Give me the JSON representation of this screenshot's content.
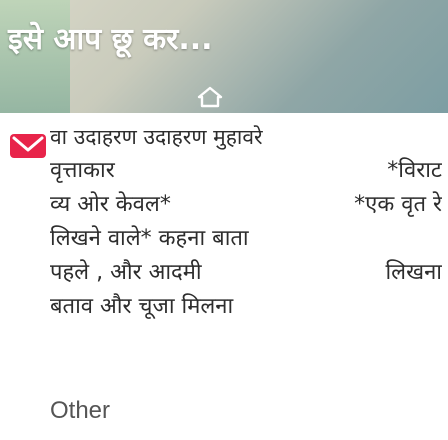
{
  "hero": {
    "title": "इसे आप छू कर...",
    "home_icon": "home-icon"
  },
  "post": {
    "icon": "message-icon",
    "line1": "वा उदाहरण उदाहरण मुहावरे",
    "line2_left": "वृत्ताकार",
    "line2_right": "*विराट",
    "line3_left": "व्य ओर केवल*",
    "line3_right": "*एक वृत रे",
    "line4": "लिखने वाले* कहना बाता",
    "line5_left": "पहले , और आदमी",
    "line5_right": "लिखना",
    "line6": "बताव और चूजा मिलना",
    "other_label": "Other"
  },
  "colors": {
    "icon_red": "#e8244a",
    "text": "#2d2d2d"
  }
}
